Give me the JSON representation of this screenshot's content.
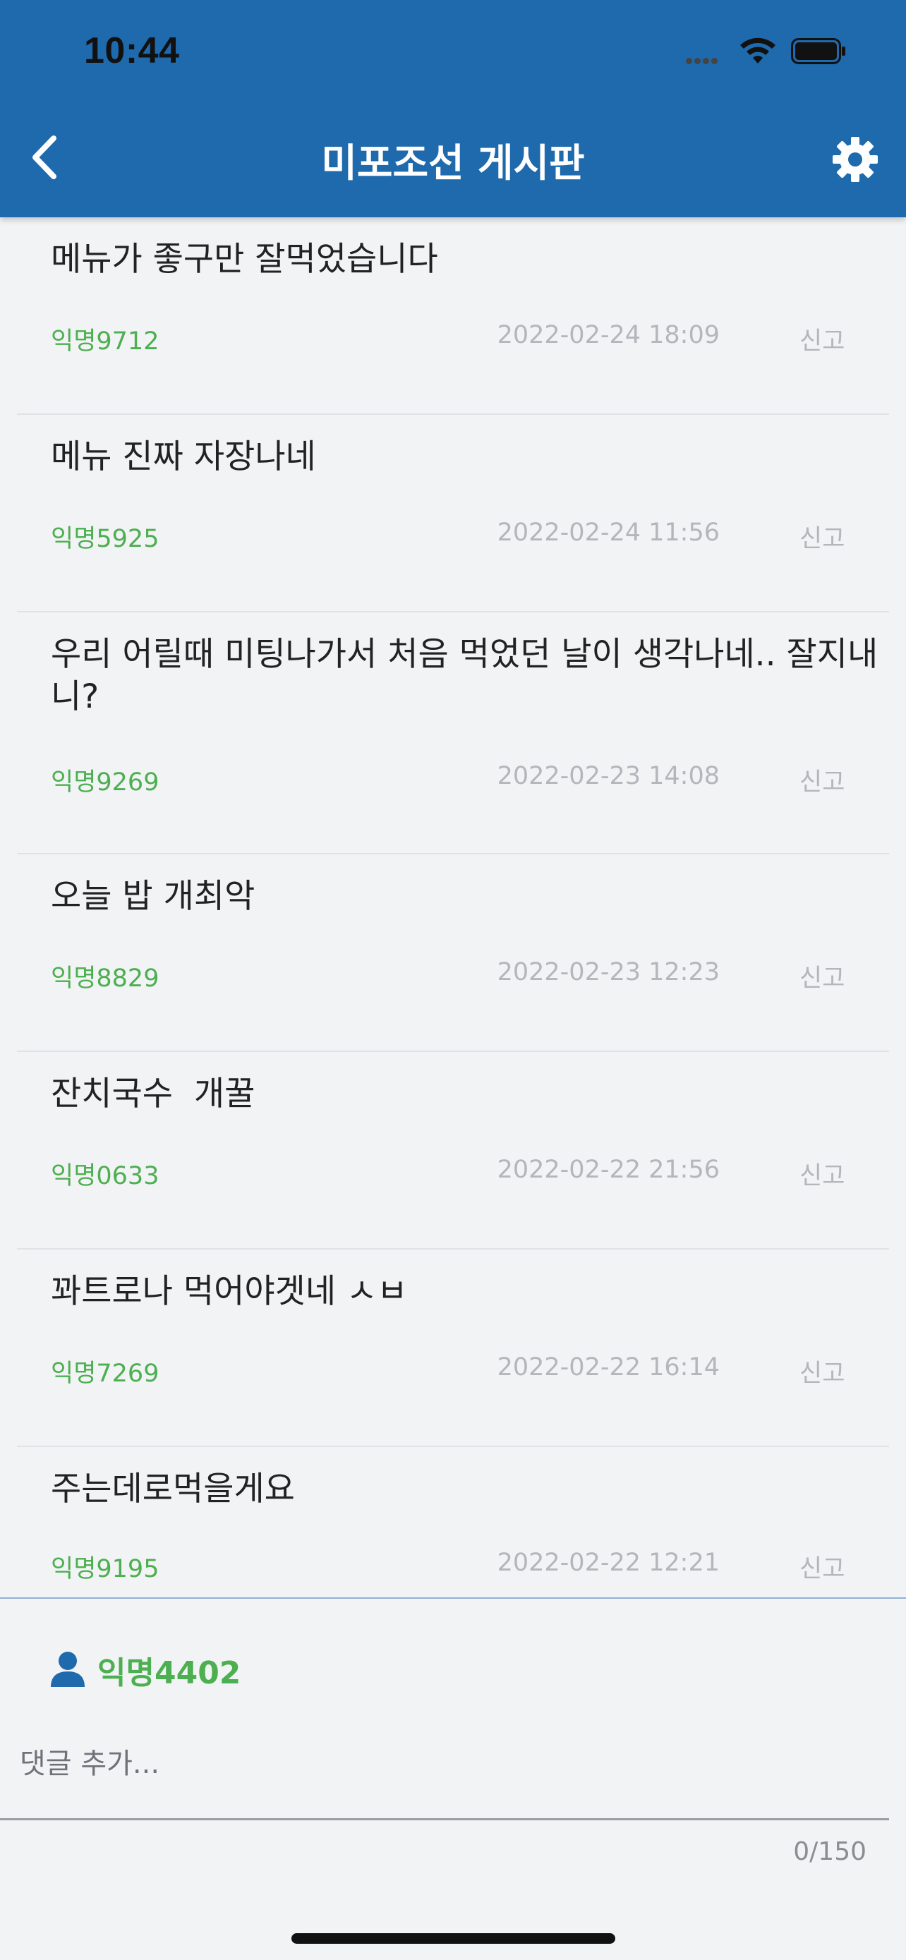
{
  "status": {
    "time": "10:44"
  },
  "header": {
    "title": "미포조선 게시판"
  },
  "colors": {
    "header_bg": "#1e6aad",
    "author": "#4caf50",
    "meta": "#b3b6bb"
  },
  "icons": {
    "back": "chevron-left-icon",
    "settings": "gear-icon",
    "user": "person-icon"
  },
  "posts": [
    {
      "text": "메뉴가 좋구만 잘먹었습니다",
      "author": "익명9712",
      "date": "2022-02-24 18:09",
      "report": "신고"
    },
    {
      "text": "메뉴 진짜 자장나네",
      "author": "익명5925",
      "date": "2022-02-24 11:56",
      "report": "신고"
    },
    {
      "text": "우리 어릴때 미팅나가서 처음 먹었던 날이 생각나네.. 잘지내니?",
      "author": "익명9269",
      "date": "2022-02-23 14:08",
      "report": "신고"
    },
    {
      "text": "오늘 밥 개최악",
      "author": "익명8829",
      "date": "2022-02-23 12:23",
      "report": "신고"
    },
    {
      "text": "잔치국수  개꿀",
      "author": "익명0633",
      "date": "2022-02-22 21:56",
      "report": "신고"
    },
    {
      "text": "꽈트로나 먹어야겟네 ㅅㅂ",
      "author": "익명7269",
      "date": "2022-02-22 16:14",
      "report": "신고"
    },
    {
      "text": "주는데로먹을게요",
      "author": "익명9195",
      "date": "2022-02-22 12:21",
      "report": "신고"
    }
  ],
  "composer": {
    "user_name": "익명4402",
    "placeholder": "댓글 추가...",
    "counter": "0/150"
  }
}
